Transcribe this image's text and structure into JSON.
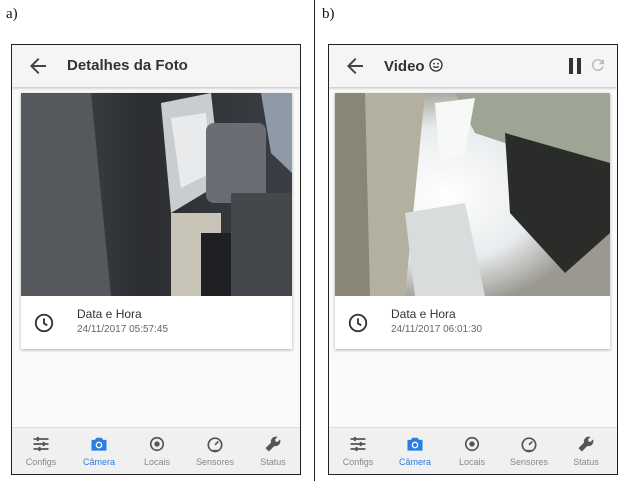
{
  "figure": {
    "label_a": "a)",
    "label_b": "b)"
  },
  "left": {
    "title": "Detalhes da Foto",
    "info_title": "Data e Hora",
    "info_value": "24/11/2017 05:57:45"
  },
  "right": {
    "title": "Video",
    "info_title": "Data e Hora",
    "info_value": "24/11/2017 06:01:30"
  },
  "nav": {
    "items": [
      {
        "label": "Configs",
        "icon": "sliders-icon"
      },
      {
        "label": "Câmera",
        "icon": "camera-icon"
      },
      {
        "label": "Locais",
        "icon": "location-icon"
      },
      {
        "label": "Sensores",
        "icon": "speedometer-icon"
      },
      {
        "label": "Status",
        "icon": "wrench-icon"
      }
    ],
    "active_index": 1
  },
  "colors": {
    "accent": "#2a7de1",
    "nav_inactive": "#888888",
    "appbar": "#f5f5f5"
  }
}
